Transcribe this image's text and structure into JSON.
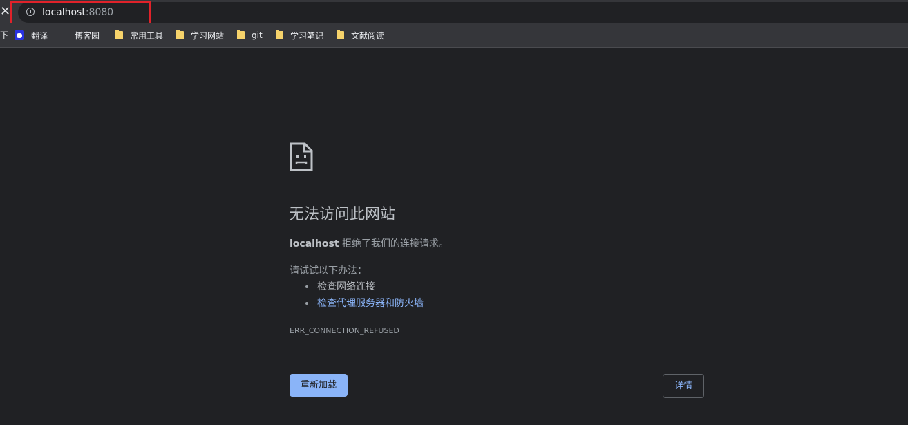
{
  "browser": {
    "close_glyph": "✕",
    "bookmarks_left_glyph": "下",
    "address": {
      "host": "localhost",
      "port": ":8080"
    },
    "bookmarks": [
      {
        "label": "翻译",
        "icon": "baidu-icon"
      },
      {
        "label": "博客园",
        "icon": "blank-icon"
      },
      {
        "label": "常用工具",
        "icon": "folder-icon"
      },
      {
        "label": "学习网站",
        "icon": "folder-icon"
      },
      {
        "label": "git",
        "icon": "folder-icon"
      },
      {
        "label": "学习笔记",
        "icon": "folder-icon"
      },
      {
        "label": "文献阅读",
        "icon": "folder-icon"
      }
    ],
    "highlight_color": "#e0222a"
  },
  "error_page": {
    "icon": "sad-page-icon",
    "headline": "无法访问此网站",
    "summary_host": "localhost",
    "summary_text": " 拒绝了我们的连接请求。",
    "try_label": "请试试以下办法：",
    "suggestions": [
      {
        "label": "检查网络连接",
        "link": false
      },
      {
        "label": "检查代理服务器和防火墙",
        "link": true
      }
    ],
    "error_code": "ERR_CONNECTION_REFUSED",
    "reload_label": "重新加载",
    "details_label": "详情"
  },
  "colors": {
    "background": "#202124",
    "link": "#8ab4f8",
    "primary_button": "#8ab4f8"
  }
}
